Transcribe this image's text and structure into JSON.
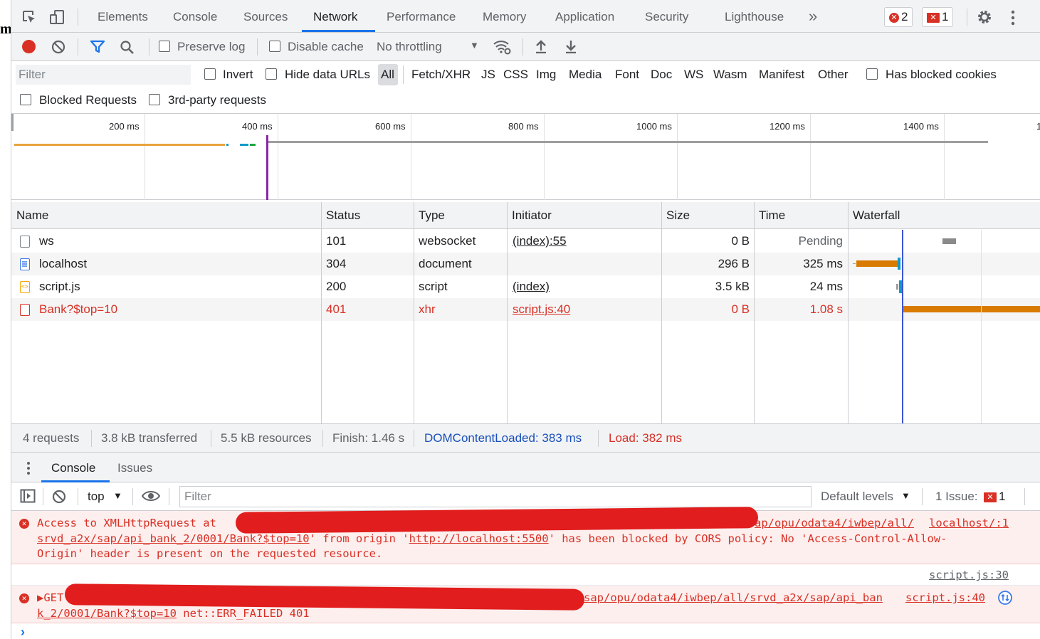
{
  "edge_glyph": "m",
  "tabs": {
    "items": [
      "Elements",
      "Console",
      "Sources",
      "Network",
      "Performance",
      "Memory",
      "Application",
      "Security",
      "Lighthouse"
    ],
    "active": "Network",
    "more": "»",
    "error_count": "2",
    "issue_count": "1"
  },
  "toolbar": {
    "preserve_log": "Preserve log",
    "disable_cache": "Disable cache",
    "throttling": "No throttling"
  },
  "filter": {
    "placeholder": "Filter",
    "invert": "Invert",
    "hide_data_urls": "Hide data URLs",
    "types": [
      "All",
      "Fetch/XHR",
      "JS",
      "CSS",
      "Img",
      "Media",
      "Font",
      "Doc",
      "WS",
      "Wasm",
      "Manifest",
      "Other"
    ],
    "has_blocked_cookies": "Has blocked cookies",
    "blocked_requests": "Blocked Requests",
    "third_party": "3rd-party requests"
  },
  "overview": {
    "ticks": [
      "200 ms",
      "400 ms",
      "600 ms",
      "800 ms",
      "1000 ms",
      "1200 ms",
      "1400 ms",
      "1"
    ]
  },
  "table": {
    "columns": [
      "Name",
      "Status",
      "Type",
      "Initiator",
      "Size",
      "Time",
      "Waterfall"
    ],
    "rows": [
      {
        "name": "ws",
        "status": "101",
        "type": "websocket",
        "initiator": "(index):55",
        "size": "0 B",
        "time": "Pending",
        "error": false
      },
      {
        "name": "localhost",
        "status": "304",
        "type": "document",
        "initiator": "",
        "size": "296 B",
        "time": "325 ms",
        "error": false
      },
      {
        "name": "script.js",
        "status": "200",
        "type": "script",
        "initiator": "(index)",
        "size": "3.5 kB",
        "time": "24 ms",
        "error": false
      },
      {
        "name": "Bank?$top=10",
        "status": "401",
        "type": "xhr",
        "initiator": "script.js:40",
        "size": "0 B",
        "time": "1.08 s",
        "error": true
      }
    ]
  },
  "summary": {
    "requests": "4 requests",
    "transferred": "3.8 kB transferred",
    "resources": "5.5 kB resources",
    "finish": "Finish: 1.46 s",
    "dcl": "DOMContentLoaded: 383 ms",
    "load": "Load: 382 ms",
    "dcl_color": "#1a4fbd",
    "load_color": "#d93025"
  },
  "drawer": {
    "tabs": [
      "Console",
      "Issues"
    ],
    "context": "top",
    "filter_placeholder": "Filter",
    "levels": "Default levels",
    "issues": "1 Issue:",
    "issues_count": "1"
  },
  "console": {
    "msg1": {
      "line1_prefix": "Access to XMLHttpRequest at",
      "line1_url_tail": "ap/opu/odata4/iwbep/all/",
      "line1_src": "localhost/:1",
      "line2_url": "srvd_a2x/sap/api_bank_2/0001/Bank?$top=10",
      "line2_mid": "' from origin '",
      "line2_origin": "http://localhost:5500",
      "line2_rest": "' has been blocked by CORS policy: No 'Access-Control-Allow-",
      "line3": "Origin' header is present on the requested resource.",
      "source": "script.js:30"
    },
    "msg2": {
      "prefix": "▶GET",
      "url_tail": "sap/opu/odata4/iwbep/all/srvd_a2x/sap/api_ban",
      "src": "script.js:40",
      "line2_url": "k_2/0001/Bank?$top=10",
      "line2_rest": " net::ERR_FAILED 401"
    },
    "prompt": "›"
  }
}
